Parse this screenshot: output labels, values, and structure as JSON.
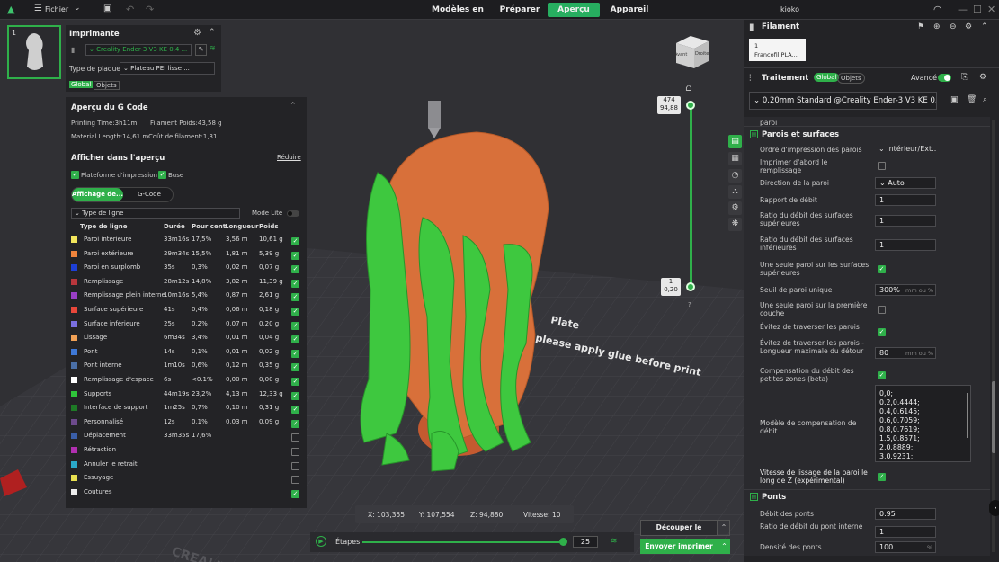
{
  "topbar": {
    "file_label": "Fichier",
    "tabs": [
      "Modèles en ligne",
      "Préparer",
      "Aperçu",
      "Appareil"
    ],
    "active_tab": "Aperçu",
    "user": "kioko"
  },
  "printer": {
    "plate_number": "1",
    "title": "Imprimante",
    "printer_name": "Creality Ender-3 V3 KE 0.4 ...",
    "plate_type_label": "Type de plaque",
    "plate_type_value": "Plateau PEI lisse ...",
    "tab_global": "Global",
    "tab_objects": "Objets"
  },
  "gcode": {
    "title": "Aperçu du G Code",
    "printing_time": "Printing Time:3h11m",
    "filament_weight": "Filament Poids:43,58 g",
    "material_length": "Material Length:14,61 m",
    "filament_cost": "Coût de filament:1,31",
    "show_title": "Afficher dans l'aperçu",
    "reduce": "Réduire",
    "show_plate": "Plateforme d'impression",
    "show_nozzle": "Buse",
    "mode_display": "Affichage de...",
    "mode_gcode": "G-Code",
    "line_type_select": "Type de ligne",
    "lite_mode": "Mode Lite",
    "headers": [
      "Type de ligne",
      "Durée",
      "Pour cent",
      "Longueur",
      "Poids"
    ],
    "rows": [
      {
        "color": "#f2e55c",
        "name": "Paroi intérieure",
        "dur": "33m16s",
        "pct": "17,5%",
        "len": "3,56 m",
        "wt": "10,61 g",
        "on": true
      },
      {
        "color": "#f0843c",
        "name": "Paroi extérieure",
        "dur": "29m34s",
        "pct": "15,5%",
        "len": "1,81 m",
        "wt": "5,39 g",
        "on": true
      },
      {
        "color": "#1d3fd6",
        "name": "Paroi en surplomb",
        "dur": "35s",
        "pct": "0,3%",
        "len": "0,02 m",
        "wt": "0,07 g",
        "on": true
      },
      {
        "color": "#b8363c",
        "name": "Remplissage",
        "dur": "28m12s",
        "pct": "14,8%",
        "len": "3,82 m",
        "wt": "11,39 g",
        "on": true
      },
      {
        "color": "#9a3fc5",
        "name": "Remplissage plein interne",
        "dur": "10m16s",
        "pct": "5,4%",
        "len": "0,87 m",
        "wt": "2,61 g",
        "on": true
      },
      {
        "color": "#e8473a",
        "name": "Surface supérieure",
        "dur": "41s",
        "pct": "0,4%",
        "len": "0,06 m",
        "wt": "0,18 g",
        "on": true
      },
      {
        "color": "#7a6fe0",
        "name": "Surface inférieure",
        "dur": "25s",
        "pct": "0,2%",
        "len": "0,07 m",
        "wt": "0,20 g",
        "on": true
      },
      {
        "color": "#f0a055",
        "name": "Lissage",
        "dur": "6m34s",
        "pct": "3,4%",
        "len": "0,01 m",
        "wt": "0,04 g",
        "on": true
      },
      {
        "color": "#3e78d6",
        "name": "Pont",
        "dur": "14s",
        "pct": "0,1%",
        "len": "0,01 m",
        "wt": "0,02 g",
        "on": true
      },
      {
        "color": "#4a6fa8",
        "name": "Pont interne",
        "dur": "1m10s",
        "pct": "0,6%",
        "len": "0,12 m",
        "wt": "0,35 g",
        "on": true
      },
      {
        "color": "#ffffff",
        "name": "Remplissage d'espace",
        "dur": "6s",
        "pct": "<0.1%",
        "len": "0,00 m",
        "wt": "0,00 g",
        "on": true
      },
      {
        "color": "#2fc43a",
        "name": "Supports",
        "dur": "44m19s",
        "pct": "23,2%",
        "len": "4,13 m",
        "wt": "12,33 g",
        "on": true
      },
      {
        "color": "#1e7a26",
        "name": "Interface de support",
        "dur": "1m25s",
        "pct": "0,7%",
        "len": "0,10 m",
        "wt": "0,31 g",
        "on": true
      },
      {
        "color": "#6d4a8c",
        "name": "Personnalisé",
        "dur": "12s",
        "pct": "0,1%",
        "len": "0,03 m",
        "wt": "0,09 g",
        "on": true
      },
      {
        "color": "#3a5ea8",
        "name": "Déplacement",
        "dur": "33m35s",
        "pct": "17,6%",
        "len": "",
        "wt": "",
        "on": false
      },
      {
        "color": "#b02fb0",
        "name": "Rétraction",
        "dur": "",
        "pct": "",
        "len": "",
        "wt": "",
        "on": false
      },
      {
        "color": "#2aa8c8",
        "name": "Annuler le retrait",
        "dur": "",
        "pct": "",
        "len": "",
        "wt": "",
        "on": false
      },
      {
        "color": "#e8e050",
        "name": "Essuyage",
        "dur": "",
        "pct": "",
        "len": "",
        "wt": "",
        "on": false
      },
      {
        "color": "#eeeeee",
        "name": "Coutures",
        "dur": "",
        "pct": "",
        "len": "",
        "wt": "",
        "on": true
      }
    ]
  },
  "viewport": {
    "cube_front": "Avant",
    "cube_right": "Droite",
    "layer_top": "474",
    "layer_top_h": "94,88",
    "layer_bottom": "1",
    "layer_bottom_h": "0,20",
    "bed_text": "please apply glue before print",
    "bed_text2": "Plate",
    "bed_logo": "CREALITY",
    "coord_x": "X: 103,355",
    "coord_y": "Y: 107,554",
    "coord_z": "Z: 94,880",
    "speed": "Vitesse: 10",
    "steps_label": "Étapes",
    "steps_value": "25",
    "slice_button": "Découper le plateau",
    "send_button": "Envoyer imprimer"
  },
  "right": {
    "filament_title": "Filament",
    "filament_slot": "1",
    "filament_name": "Francofil PLA...",
    "process_title": "Traitement",
    "tab_global": "Global",
    "tab_objects": "Objets",
    "advanced": "Avancé",
    "profile": "0.20mm Standard @Creality Ender-3 V3 KE 0...",
    "partial_label": "paroi",
    "section_walls": "Parois et surfaces",
    "order_label": "Ordre d'impression des parois",
    "order_value": "Intérieur/Ext...",
    "print_first_label": "Imprimer d'abord le remplissage",
    "direction_label": "Direction de la paroi",
    "direction_value": "Auto",
    "flow_label": "Rapport de débit",
    "flow_value": "1",
    "top_flow_label": "Ratio du débit des surfaces supérieures",
    "top_flow_value": "1",
    "bottom_flow_label": "Ratio du débit des surfaces inférieures",
    "bottom_flow_value": "1",
    "single_top_label": "Une seule paroi sur les surfaces supérieures",
    "single_threshold_label": "Seuil de paroi unique",
    "single_threshold_value": "300%",
    "single_threshold_unit": "mm ou %",
    "single_first_label": "Une seule paroi sur la première couche",
    "avoid_label": "Évitez de traverser les parois",
    "avoid_max_label": "Évitez de traverser les parois - Longueur maximale du détour",
    "avoid_max_value": "80",
    "avoid_max_unit": "mm ou %",
    "small_comp_label": "Compensation du débit des petites zones (beta)",
    "model_label": "Modèle de compensation de débit",
    "model_values": [
      "0,0;",
      "0.2,0.4444;",
      "0.4,0.6145;",
      "0.6,0.7059;",
      "0.8,0.7619;",
      "1.5,0.8571;",
      "2,0.8889;",
      "3,0.9231;"
    ],
    "smooth_label": "Vitesse de lissage de la paroi le long de Z (expérimental)",
    "section_bridges": "Ponts",
    "bridge_flow_label": "Débit des ponts",
    "bridge_flow_value": "0.95",
    "internal_bridge_label": "Ratio de débit du pont interne",
    "internal_bridge_value": "1",
    "bridge_density_label": "Densité des ponts",
    "bridge_density_value": "100",
    "bridge_density_unit": "%"
  }
}
